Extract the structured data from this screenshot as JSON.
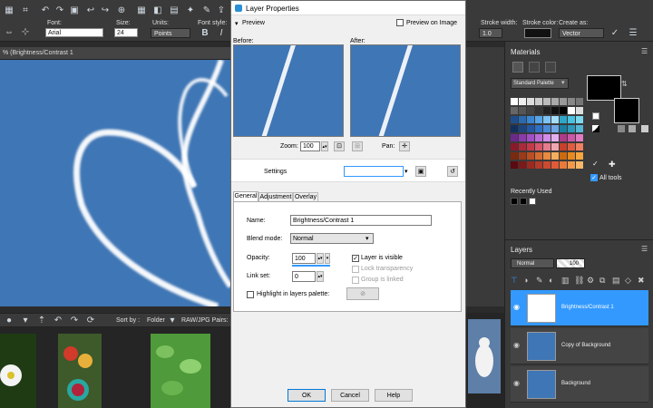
{
  "toolbar": {
    "font_label": "Font:",
    "font_value": "Arial",
    "size_label": "Size:",
    "size_value": "24",
    "units_label": "Units:",
    "units_value": "Points",
    "font_style_label": "Font style:",
    "bold": "B",
    "italic": "I",
    "stroke_width_label": "Stroke width:",
    "stroke_width_value": "1.0",
    "stroke_color_label": "Stroke color:",
    "create_as_label": "Create as:",
    "create_as_value": "Vector"
  },
  "document": {
    "tab_title": "% (Brightness/Contrast 1"
  },
  "organizer": {
    "sort_by_label": "Sort by :",
    "sort_by_value": "Folder",
    "raw_label": "RAW/JPG Pairs:"
  },
  "dialog": {
    "title": "Layer Properties",
    "preview_label": "Preview",
    "preview_on_image_label": "Preview on Image",
    "before_label": "Before:",
    "after_label": "After:",
    "zoom_label": "Zoom:",
    "zoom_value": "100",
    "pan_label": "Pan:",
    "settings_label": "Settings",
    "tabs": [
      "General",
      "Adjustment",
      "Overlay"
    ],
    "name_label": "Name:",
    "name_value": "Brightness/Contrast 1",
    "blend_mode_label": "Blend mode:",
    "blend_mode_value": "Normal",
    "opacity_label": "Opacity:",
    "opacity_value": "100",
    "link_set_label": "Link set:",
    "link_set_value": "0",
    "layer_visible_label": "Layer is visible",
    "lock_transparency_label": "Lock transparency",
    "group_linked_label": "Group is linked",
    "highlight_label": "Highlight in layers palette:",
    "ok_label": "OK",
    "cancel_label": "Cancel",
    "help_label": "Help"
  },
  "materials": {
    "title": "Materials",
    "palette_value": "Standard Palette",
    "recently_used_label": "Recently Used",
    "all_tools_label": "All tools"
  },
  "layers": {
    "title": "Layers",
    "blend_value": "Normal",
    "opacity_value": "100",
    "items": [
      {
        "name": "Brightness/Contrast 1"
      },
      {
        "name": "Copy of Background"
      },
      {
        "name": "Background"
      }
    ]
  },
  "colors": {
    "accent": "#3399ff",
    "sky": "#3f76b5",
    "panel": "#3a3a3a"
  }
}
